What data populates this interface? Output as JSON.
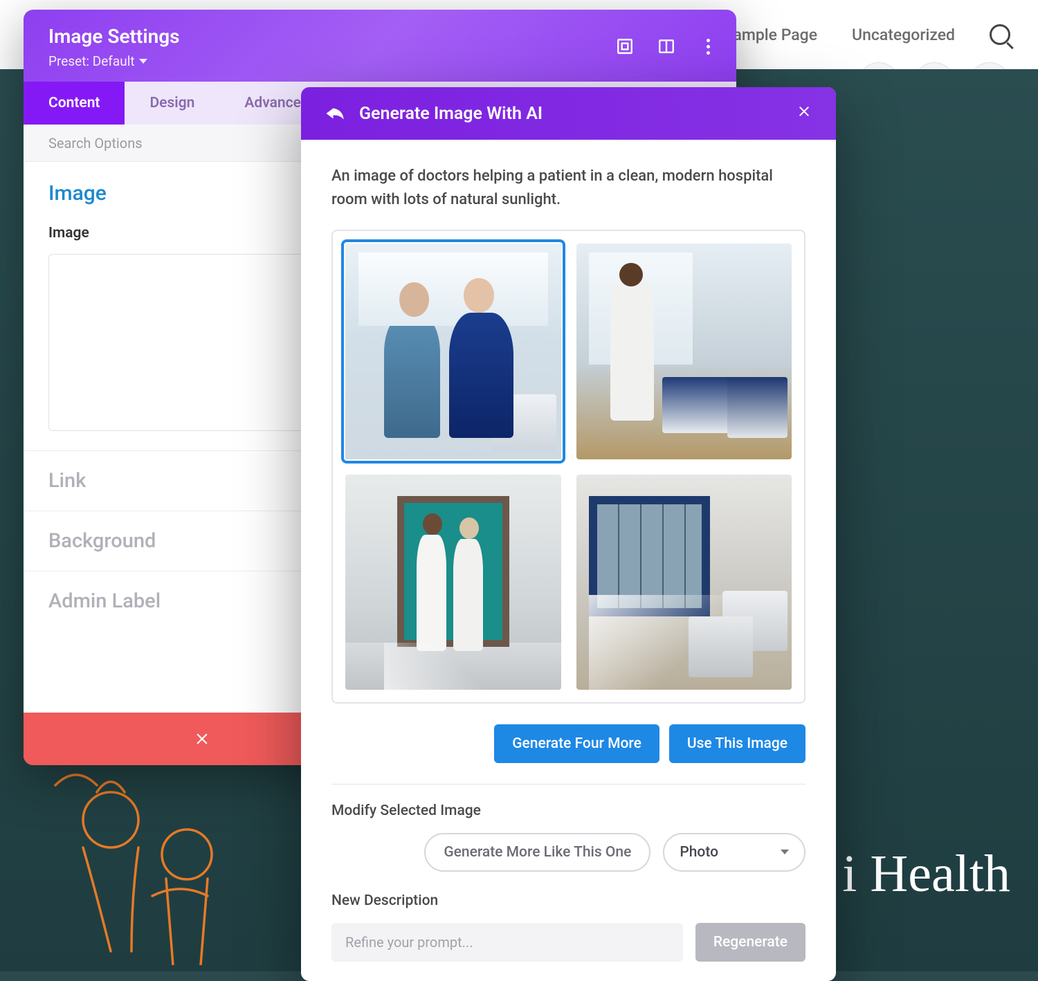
{
  "top_nav": {
    "items": [
      "ple",
      "Sample Page",
      "Uncategorized"
    ]
  },
  "hero": {
    "text": "i Health"
  },
  "settings_panel": {
    "title": "Image Settings",
    "preset_label": "Preset: Default",
    "tabs": [
      "Content",
      "Design",
      "Advanced"
    ],
    "search_placeholder": "Search Options",
    "section_title": "Image",
    "field_label": "Image",
    "accordion": [
      "Link",
      "Background",
      "Admin Label"
    ]
  },
  "ai_modal": {
    "title": "Generate Image With AI",
    "prompt": "An image of doctors helping a patient in a clean, modern hospital room with lots of natural sunlight.",
    "generate_more": "Generate Four More",
    "use_image": "Use This Image",
    "modify_label": "Modify Selected Image",
    "more_like": "Generate More Like This One",
    "style_select": "Photo",
    "new_desc_label": "New Description",
    "refine_placeholder": "Refine your prompt...",
    "regenerate": "Regenerate"
  }
}
